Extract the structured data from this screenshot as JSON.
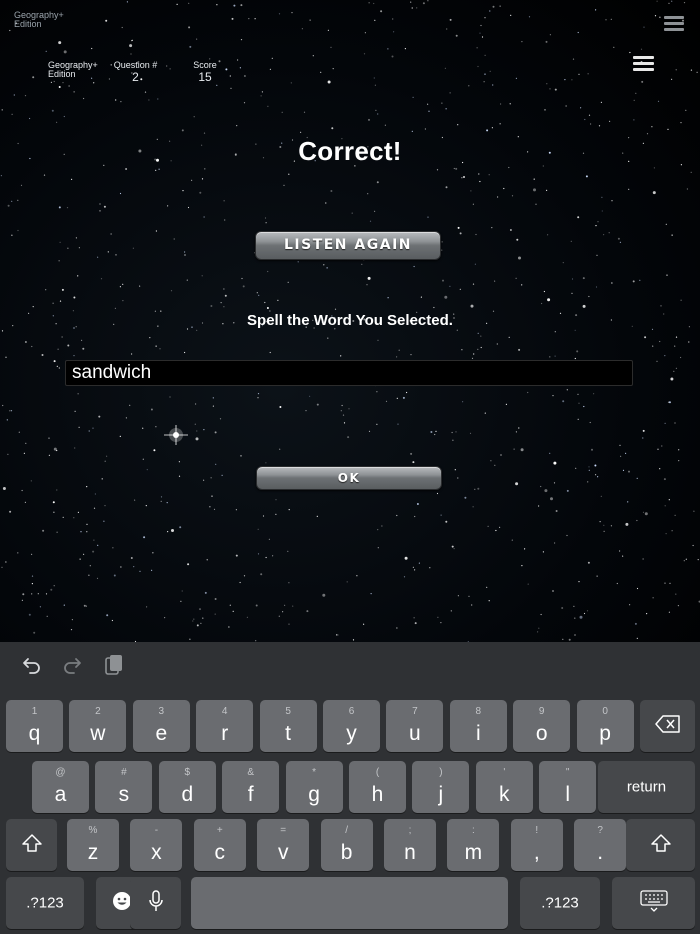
{
  "header": {
    "corner_title": "Geography+\nEdition",
    "edition_label": "Geography+\nEdition",
    "question_label": "Question #",
    "question_value": "2",
    "score_label": "Score",
    "score_value": "15"
  },
  "result": "Correct!",
  "listen_button": "LISTEN AGAIN",
  "prompt": "Spell the Word You Selected.",
  "answer_value": "sandwich",
  "ok_button": "OK",
  "keyboard": {
    "toolbar": {
      "undo_icon": "undo-icon",
      "redo_icon": "redo-icon",
      "paste_icon": "paste-icon"
    },
    "row1": [
      {
        "hint": "1",
        "key": "q"
      },
      {
        "hint": "2",
        "key": "w"
      },
      {
        "hint": "3",
        "key": "e"
      },
      {
        "hint": "4",
        "key": "r"
      },
      {
        "hint": "5",
        "key": "t"
      },
      {
        "hint": "6",
        "key": "y"
      },
      {
        "hint": "7",
        "key": "u"
      },
      {
        "hint": "8",
        "key": "i"
      },
      {
        "hint": "9",
        "key": "o"
      },
      {
        "hint": "0",
        "key": "p"
      }
    ],
    "row2": [
      {
        "hint": "@",
        "key": "a"
      },
      {
        "hint": "#",
        "key": "s"
      },
      {
        "hint": "$",
        "key": "d"
      },
      {
        "hint": "&",
        "key": "f"
      },
      {
        "hint": "*",
        "key": "g"
      },
      {
        "hint": "(",
        "key": "h"
      },
      {
        "hint": ")",
        "key": "j"
      },
      {
        "hint": "'",
        "key": "k"
      },
      {
        "hint": "\"",
        "key": "l"
      }
    ],
    "row3": [
      {
        "hint": "%",
        "key": "z"
      },
      {
        "hint": "-",
        "key": "x"
      },
      {
        "hint": "+",
        "key": "c"
      },
      {
        "hint": "=",
        "key": "v"
      },
      {
        "hint": "/",
        "key": "b"
      },
      {
        "hint": ";",
        "key": "n"
      },
      {
        "hint": ":",
        "key": "m"
      },
      {
        "hint": "!",
        "key": ","
      },
      {
        "hint": "?",
        "key": "."
      }
    ],
    "return_label": "return",
    "numbers_label": ".?123",
    "backspace_icon": "backspace-icon",
    "shift_icon": "shift-icon",
    "emoji_icon": "emoji-icon",
    "mic_icon": "microphone-icon",
    "hide_keyboard_icon": "keyboard-hide-icon"
  }
}
